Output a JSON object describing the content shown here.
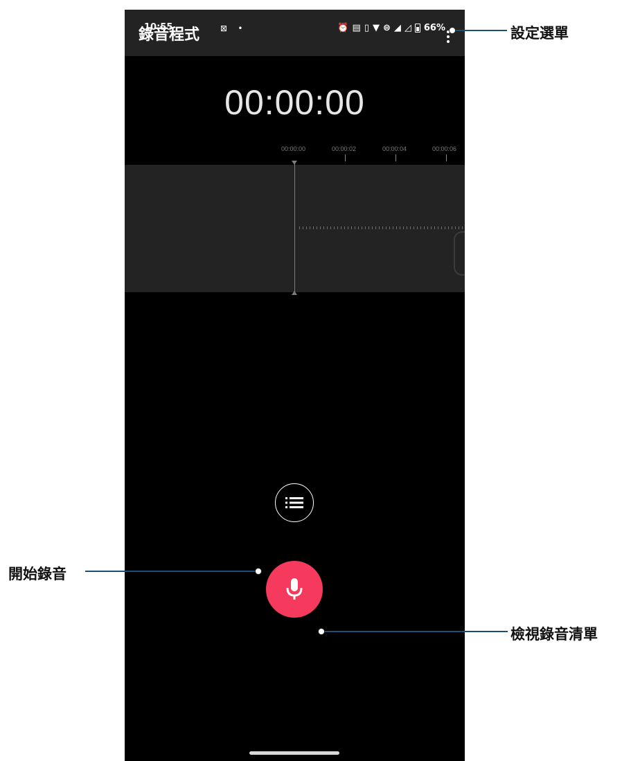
{
  "status_bar": {
    "time": "10:55",
    "battery_percent": "66%",
    "left_icons": [
      "settings-gear-icon",
      "bulb-icon",
      "image-icon",
      "dot-icon"
    ],
    "right_icons": [
      "alarm-icon",
      "auto-icon",
      "vibrate-icon",
      "wifi-icon",
      "volte-icon",
      "sim-icon",
      "signal-icon",
      "no-signal-icon",
      "battery-icon"
    ]
  },
  "app_bar": {
    "title": "錄音程式",
    "menu_icon": "more-vert-icon"
  },
  "recorder": {
    "elapsed": "00:00:00",
    "timeline_labels": [
      "00:00:00",
      "00:00:02",
      "00:00:04",
      "00:00:06"
    ]
  },
  "controls": {
    "list_icon": "list-icon",
    "record_icon": "mic-icon",
    "record_color": "#f53a5d"
  },
  "annotations": {
    "settings_menu": "設定選單",
    "view_recordings": "檢視錄音清單",
    "start_recording": "開始錄音",
    "line_color": "#1d4e73"
  }
}
